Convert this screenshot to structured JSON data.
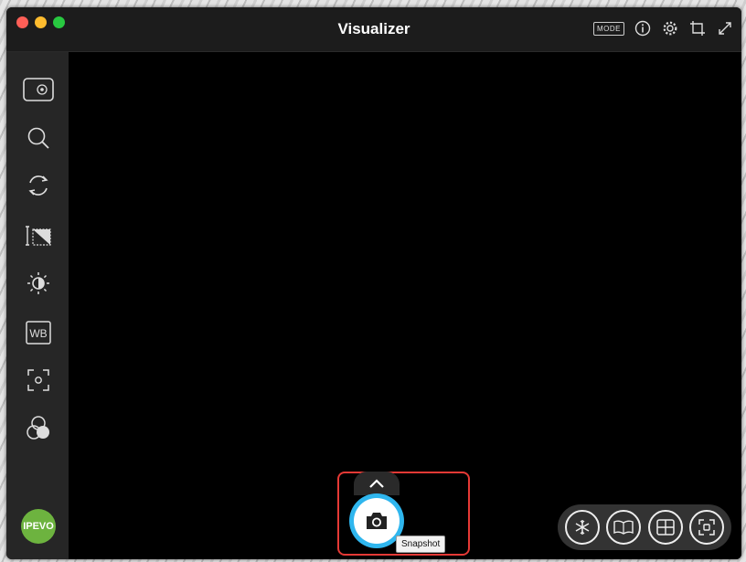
{
  "window": {
    "title": "Visualizer"
  },
  "titlebar": {
    "mode_label": "MODE",
    "icons": [
      "info-icon",
      "gear-icon",
      "crop-icon",
      "expand-icon"
    ]
  },
  "sidebar": {
    "items": [
      {
        "name": "camera-source",
        "icon": "camera-source-icon"
      },
      {
        "name": "zoom",
        "icon": "magnifier-icon"
      },
      {
        "name": "rotate",
        "icon": "rotate-icon"
      },
      {
        "name": "mirror",
        "icon": "mirror-icon"
      },
      {
        "name": "exposure",
        "icon": "brightness-icon"
      },
      {
        "name": "white-balance",
        "icon": "wb-icon",
        "label": "WB"
      },
      {
        "name": "focus",
        "icon": "focus-icon"
      },
      {
        "name": "color-filter",
        "icon": "filter-icon"
      }
    ],
    "logo_label": "IPEVO"
  },
  "bottom": {
    "snapshot_tooltip": "Snapshot",
    "tools": [
      "freeze-icon",
      "book-icon",
      "split-icon",
      "capture-area-icon"
    ]
  },
  "colors": {
    "accent": "#2fb6ee",
    "logo": "#6db33f",
    "highlight": "#e53935"
  }
}
